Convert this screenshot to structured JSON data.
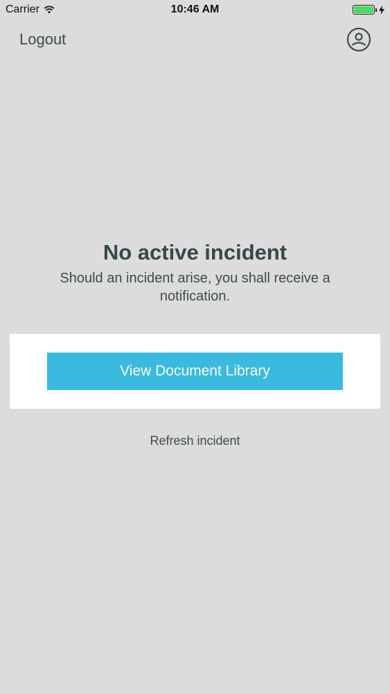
{
  "status_bar": {
    "carrier": "Carrier",
    "time": "10:46 AM",
    "icons": [
      "wifi-icon",
      "battery-icon",
      "charging-icon"
    ],
    "battery_color": "#4cd964"
  },
  "nav": {
    "logout_label": "Logout",
    "profile_icon": "user-circle-icon"
  },
  "message": {
    "title": "No active incident",
    "body": "Should an incident arise, you shall receive a notification."
  },
  "actions": {
    "library_button_label": "View Document Library",
    "refresh_label": "Refresh incident"
  },
  "colors": {
    "background": "#dddcdd",
    "accent": "#3abadf",
    "text": "#3d4b4d",
    "card": "#ffffff"
  }
}
